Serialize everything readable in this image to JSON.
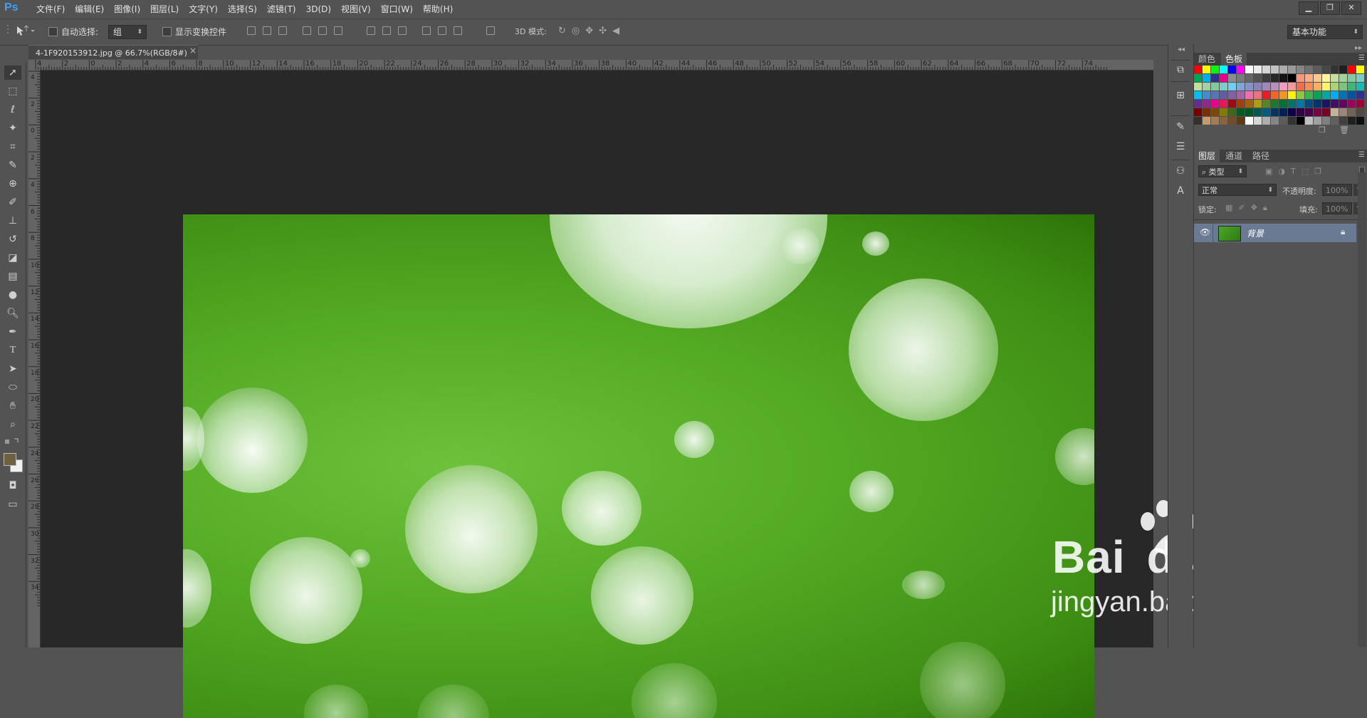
{
  "app": {
    "logo": "Ps"
  },
  "menu": [
    "文件(F)",
    "编辑(E)",
    "图像(I)",
    "图层(L)",
    "文字(Y)",
    "选择(S)",
    "滤镜(T)",
    "3D(D)",
    "视图(V)",
    "窗口(W)",
    "帮助(H)"
  ],
  "options": {
    "auto_select_label": "自动选择:",
    "auto_select_value": "组",
    "show_transform_label": "显示变换控件",
    "mode_3d_label": "3D 模式:",
    "workspace": "基本功能"
  },
  "document": {
    "tab_title": "4-1F920153912.jpg @ 66.7%(RGB/8#)",
    "close_glyph": "×"
  },
  "rulers": {
    "top_labels": [
      "4",
      "2",
      "0",
      "2",
      "4",
      "6",
      "8",
      "10",
      "12",
      "14",
      "16",
      "18",
      "20",
      "22",
      "24",
      "26",
      "28",
      "30",
      "32",
      "34",
      "36",
      "38",
      "40",
      "42",
      "44",
      "46",
      "48",
      "50",
      "52",
      "54",
      "56",
      "58",
      "60",
      "62",
      "64",
      "66",
      "68",
      "70",
      "72",
      "74"
    ],
    "left_labels": [
      "4",
      "2",
      "0",
      "2",
      "4",
      "6",
      "8",
      "10",
      "12",
      "14",
      "16",
      "18",
      "20",
      "22",
      "24",
      "26",
      "28",
      "30",
      "32",
      "34"
    ]
  },
  "panels": {
    "color_tabs": [
      "颜色",
      "色板"
    ],
    "layer_tabs": [
      "图层",
      "通道",
      "路径"
    ],
    "layer_filter": "类型",
    "blend_mode": "正常",
    "opacity_label": "不透明度:",
    "opacity_value": "100%",
    "lock_label": "锁定:",
    "fill_label": "填充:",
    "fill_value": "100%",
    "layer_name": "背景"
  },
  "watermark": {
    "brand_text": "Bai",
    "brand_du": "du",
    "brand_cn": "经验",
    "url": "jingyan.baidu.com"
  },
  "colors": {
    "accent": "#3fa1f5",
    "panel_bg": "#535353",
    "canvas_bg": "#282828",
    "layer_selected": "#6a7a92"
  }
}
